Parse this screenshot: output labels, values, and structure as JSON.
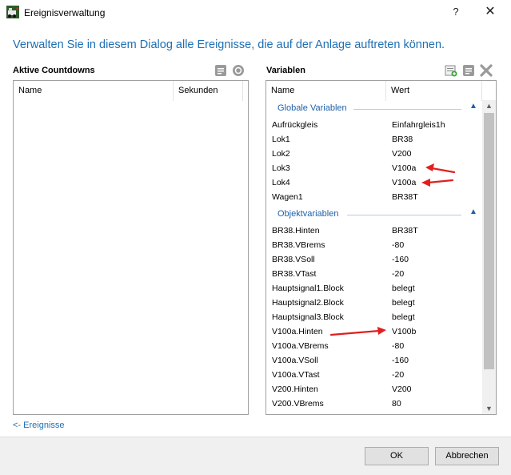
{
  "window": {
    "title": "Ereignisverwaltung",
    "help_label": "?",
    "close_label": "✕"
  },
  "intro": "Verwalten Sie in diesem Dialog alle Ereignisse, die auf der Anlage auftreten können.",
  "countdowns": {
    "title": "Aktive Countdowns",
    "columns": [
      "Name",
      "Sekunden"
    ]
  },
  "variables": {
    "title": "Variablen",
    "columns": [
      "Name",
      "Wert"
    ],
    "groups": [
      {
        "label": "Globale Variablen",
        "rows": [
          {
            "name": "Aufrückgleis",
            "value": "Einfahrgleis1h"
          },
          {
            "name": "Lok1",
            "value": "BR38"
          },
          {
            "name": "Lok2",
            "value": "V200"
          },
          {
            "name": "Lok3",
            "value": "V100a"
          },
          {
            "name": "Lok4",
            "value": "V100a"
          },
          {
            "name": "Wagen1",
            "value": "BR38T"
          }
        ]
      },
      {
        "label": "Objektvariablen",
        "rows": [
          {
            "name": "BR38.Hinten",
            "value": "BR38T"
          },
          {
            "name": "BR38.VBrems",
            "value": "-80"
          },
          {
            "name": "BR38.VSoll",
            "value": "-160"
          },
          {
            "name": "BR38.VTast",
            "value": "-20"
          },
          {
            "name": "Hauptsignal1.Block",
            "value": "belegt"
          },
          {
            "name": "Hauptsignal2.Block",
            "value": "belegt"
          },
          {
            "name": "Hauptsignal3.Block",
            "value": "belegt"
          },
          {
            "name": "V100a.Hinten",
            "value": "V100b"
          },
          {
            "name": "V100a.VBrems",
            "value": "-80"
          },
          {
            "name": "V100a.VSoll",
            "value": "-160"
          },
          {
            "name": "V100a.VTast",
            "value": "-20"
          },
          {
            "name": "V200.Hinten",
            "value": "V200"
          },
          {
            "name": "V200.VBrems",
            "value": "80"
          }
        ]
      }
    ]
  },
  "link": "<- Ereignisse",
  "buttons": {
    "ok": "OK",
    "cancel": "Abbrechen"
  },
  "colors": {
    "accent": "#1e6fb4",
    "annotation_arrow": "#e02020"
  },
  "icons": {
    "app": "train-icon",
    "countdown_tools": [
      "edit-icon",
      "stop-icon"
    ],
    "variable_tools": [
      "add-variable-icon",
      "edit-icon",
      "delete-icon"
    ]
  }
}
